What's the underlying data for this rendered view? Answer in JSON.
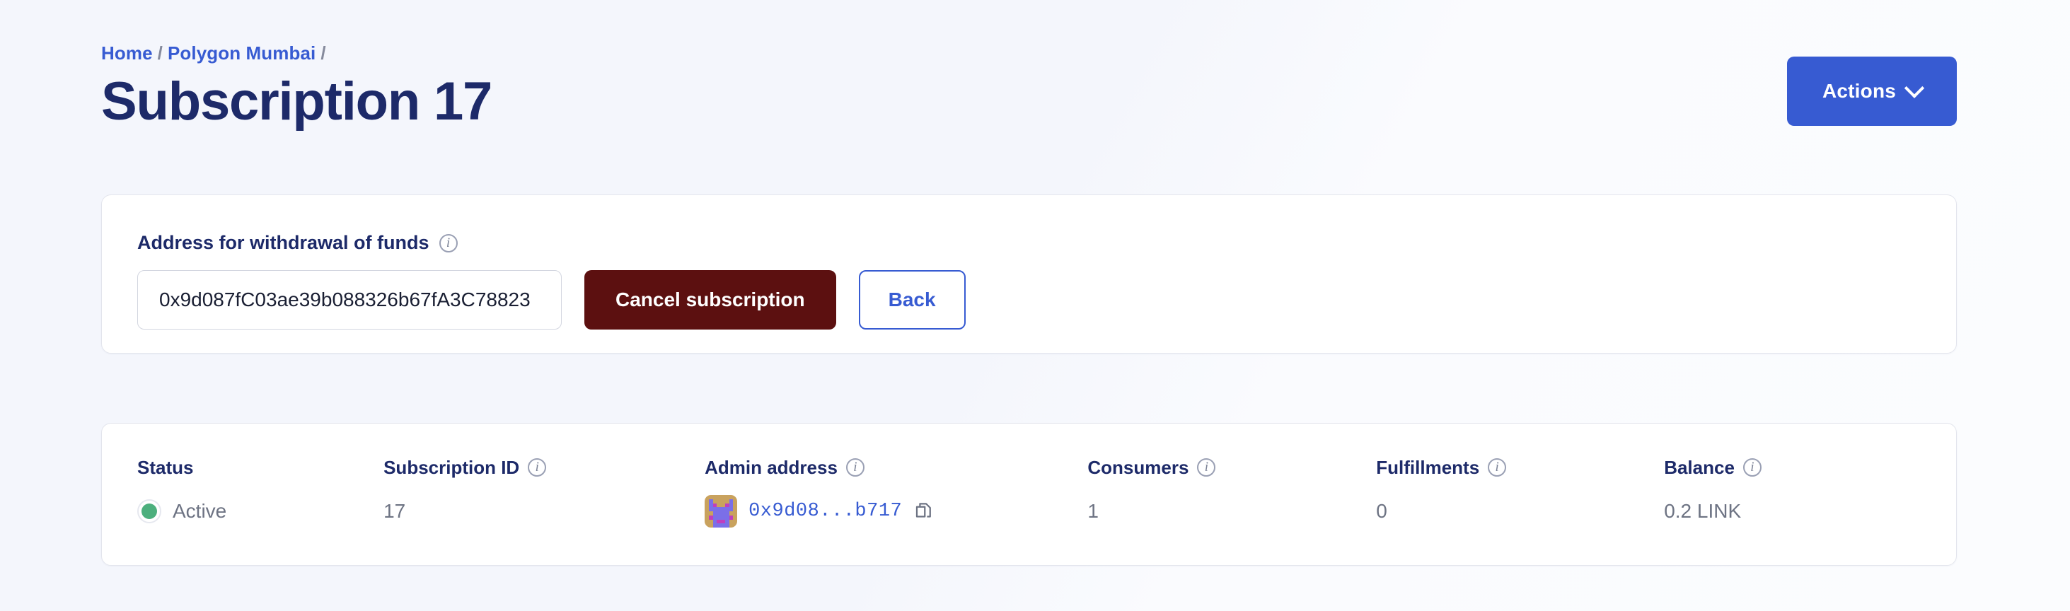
{
  "header": {
    "breadcrumb": [
      {
        "label": "Home",
        "type": "link"
      },
      {
        "label": "/",
        "type": "separator"
      },
      {
        "label": "Polygon Mumbai",
        "type": "link"
      },
      {
        "label": "/",
        "type": "separator"
      }
    ],
    "title": "Subscription 17",
    "actions_label": "Actions",
    "actions_icon": "chevron-down-icon",
    "accent_color": "#375bd2",
    "title_color": "#1d2a69"
  },
  "withdrawal_card": {
    "label": "Address for withdrawal of funds",
    "label_info_icon": "info-icon",
    "address_value": "0x9d087fC03ae39b088326b67fA3C78823",
    "address_placeholder": "Address for withdrawal of funds",
    "cancel_label": "Cancel subscription",
    "cancel_color": "#5c1010",
    "back_label": "Back"
  },
  "stats": {
    "columns": [
      {
        "header": "Status",
        "has_info_icon": false,
        "value": "Active",
        "kind": "status",
        "dot_color": "#4caf7d"
      },
      {
        "header": "Subscription ID",
        "has_info_icon": true,
        "value": "17",
        "kind": "text"
      },
      {
        "header": "Admin address",
        "has_info_icon": true,
        "value": "0x9d08...b717",
        "kind": "address",
        "avatar_icon": "blockie-avatar",
        "copy_icon": "copy-icon"
      },
      {
        "header": "Consumers",
        "has_info_icon": true,
        "value": "1",
        "kind": "text"
      },
      {
        "header": "Fulfillments",
        "has_info_icon": true,
        "value": "0",
        "kind": "text"
      },
      {
        "header": "Balance",
        "has_info_icon": true,
        "value": "0.2 LINK",
        "kind": "text"
      }
    ]
  },
  "blockie": {
    "bg": "#c9a25e",
    "fg": "#7b6fe8",
    "spot": "#bf3fbf",
    "grid": [
      [
        0,
        0,
        0,
        0,
        0,
        0,
        0,
        0
      ],
      [
        0,
        1,
        0,
        0,
        0,
        0,
        1,
        0
      ],
      [
        0,
        1,
        2,
        0,
        0,
        2,
        1,
        0
      ],
      [
        0,
        1,
        1,
        1,
        1,
        1,
        1,
        0
      ],
      [
        0,
        0,
        1,
        1,
        1,
        1,
        0,
        0
      ],
      [
        0,
        2,
        1,
        1,
        1,
        1,
        2,
        0
      ],
      [
        0,
        0,
        1,
        2,
        2,
        1,
        0,
        0
      ],
      [
        0,
        0,
        1,
        1,
        1,
        1,
        0,
        0
      ]
    ]
  }
}
